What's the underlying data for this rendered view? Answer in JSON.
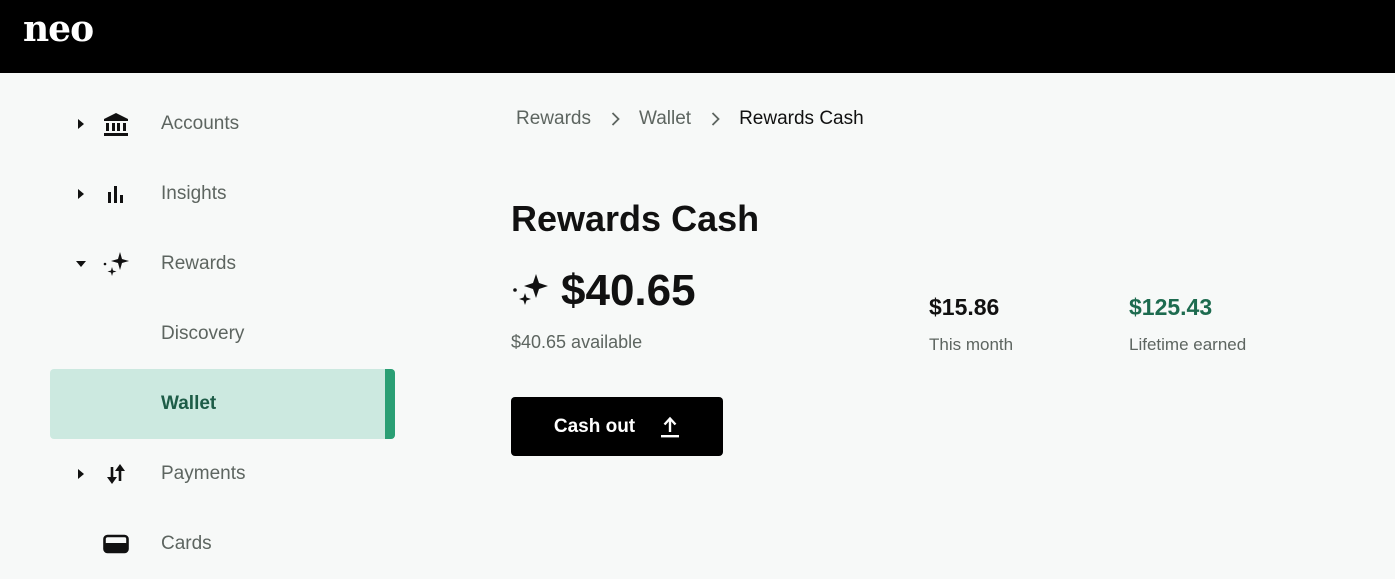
{
  "app": {
    "logo": "neo"
  },
  "sidebar": {
    "items": [
      {
        "label": "Accounts"
      },
      {
        "label": "Insights"
      },
      {
        "label": "Rewards"
      },
      {
        "label": "Discovery"
      },
      {
        "label": "Wallet"
      },
      {
        "label": "Payments"
      },
      {
        "label": "Cards"
      }
    ]
  },
  "breadcrumb": [
    "Rewards",
    "Wallet",
    "Rewards Cash"
  ],
  "main": {
    "title": "Rewards Cash",
    "balance": "$40.65",
    "available": "$40.65 available",
    "stats": [
      {
        "value": "$15.86",
        "label": "This month",
        "color": "#111111"
      },
      {
        "value": "$125.43",
        "label": "Lifetime earned",
        "color": "#1d6b4f"
      }
    ],
    "cashout_label": "Cash out"
  },
  "colors": {
    "topbar": "#000000",
    "active_bg": "#cce9e0",
    "active_bar": "#2a9f74",
    "accent_text": "#1d5c47"
  }
}
